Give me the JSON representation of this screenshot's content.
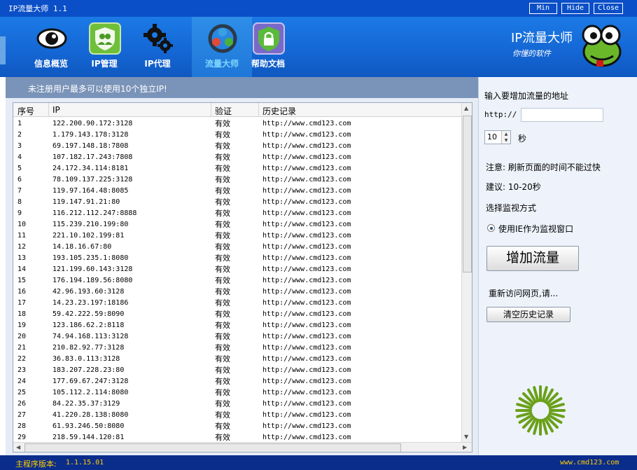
{
  "window": {
    "title": "IP流量大师 1.1",
    "buttons": {
      "min": "Min",
      "hide": "Hide",
      "close": "Close"
    }
  },
  "nav": {
    "items": [
      {
        "label": "信息概览",
        "icon": "eye-icon"
      },
      {
        "label": "IP管理",
        "icon": "users-shield-icon"
      },
      {
        "label": "IP代理",
        "icon": "gears-icon"
      },
      {
        "label": "流量大师",
        "icon": "traffic-icon",
        "active": true
      },
      {
        "label": "帮助文档",
        "icon": "lock-shield-icon"
      }
    ]
  },
  "brand": {
    "name": "IP流量大师",
    "slogan": "你懂的软件"
  },
  "notice": "未注册用户最多可以使用10个独立IP!",
  "table": {
    "columns": [
      "序号",
      "IP",
      "验证",
      "历史记录"
    ],
    "rows": [
      [
        "1",
        "122.200.90.172:3128",
        "有效",
        "http://www.cmd123.com"
      ],
      [
        "2",
        "1.179.143.178:3128",
        "有效",
        "http://www.cmd123.com"
      ],
      [
        "3",
        "69.197.148.18:7808",
        "有效",
        "http://www.cmd123.com"
      ],
      [
        "4",
        "107.182.17.243:7808",
        "有效",
        "http://www.cmd123.com"
      ],
      [
        "5",
        "24.172.34.114:8181",
        "有效",
        "http://www.cmd123.com"
      ],
      [
        "6",
        "78.109.137.225:3128",
        "有效",
        "http://www.cmd123.com"
      ],
      [
        "7",
        "119.97.164.48:8085",
        "有效",
        "http://www.cmd123.com"
      ],
      [
        "8",
        "119.147.91.21:80",
        "有效",
        "http://www.cmd123.com"
      ],
      [
        "9",
        "116.212.112.247:8888",
        "有效",
        "http://www.cmd123.com"
      ],
      [
        "10",
        "115.239.210.199:80",
        "有效",
        "http://www.cmd123.com"
      ],
      [
        "11",
        "221.10.102.199:81",
        "有效",
        "http://www.cmd123.com"
      ],
      [
        "12",
        "14.18.16.67:80",
        "有效",
        "http://www.cmd123.com"
      ],
      [
        "13",
        "193.105.235.1:8080",
        "有效",
        "http://www.cmd123.com"
      ],
      [
        "14",
        "121.199.60.143:3128",
        "有效",
        "http://www.cmd123.com"
      ],
      [
        "15",
        "176.194.189.56:8080",
        "有效",
        "http://www.cmd123.com"
      ],
      [
        "16",
        "42.96.193.60:3128",
        "有效",
        "http://www.cmd123.com"
      ],
      [
        "17",
        "14.23.23.197:18186",
        "有效",
        "http://www.cmd123.com"
      ],
      [
        "18",
        "59.42.222.59:8090",
        "有效",
        "http://www.cmd123.com"
      ],
      [
        "19",
        "123.186.62.2:8118",
        "有效",
        "http://www.cmd123.com"
      ],
      [
        "20",
        "74.94.168.113:3128",
        "有效",
        "http://www.cmd123.com"
      ],
      [
        "21",
        "210.82.92.77:3128",
        "有效",
        "http://www.cmd123.com"
      ],
      [
        "22",
        "36.83.0.113:3128",
        "有效",
        "http://www.cmd123.com"
      ],
      [
        "23",
        "183.207.228.23:80",
        "有效",
        "http://www.cmd123.com"
      ],
      [
        "24",
        "177.69.67.247:3128",
        "有效",
        "http://www.cmd123.com"
      ],
      [
        "25",
        "105.112.2.114:8080",
        "有效",
        "http://www.cmd123.com"
      ],
      [
        "26",
        "84.22.35.37:3129",
        "有效",
        "http://www.cmd123.com"
      ],
      [
        "27",
        "41.220.28.138:8080",
        "有效",
        "http://www.cmd123.com"
      ],
      [
        "28",
        "61.93.246.50:8080",
        "有效",
        "http://www.cmd123.com"
      ],
      [
        "29",
        "218.59.144.120:81",
        "有效",
        "http://www.cmd123.com"
      ]
    ]
  },
  "panel": {
    "url_label": "输入要增加流量的地址",
    "http_prefix": "http://",
    "url_value": "",
    "seconds_value": "10",
    "seconds_unit": "秒",
    "note": "注意: 刷新页面的时间不能过快",
    "suggest": "建议: 10-20秒",
    "monitor_title": "选择监视方式",
    "monitor_option": "使用IE作为监视窗口",
    "add_button": "增加流量",
    "status_text": "重新访问网页,请...",
    "clear_button": "清空历史记录"
  },
  "statusbar": {
    "version_label": "主程序版本:",
    "version": "1.1.15.01",
    "site": "www.cmd123.com"
  },
  "colors": {
    "titlebar": "#0a4fc7",
    "header": "#1466d4",
    "statusbar": "#0a2d8c",
    "status_text": "#ffcc00",
    "loader": "#6aa01a"
  }
}
